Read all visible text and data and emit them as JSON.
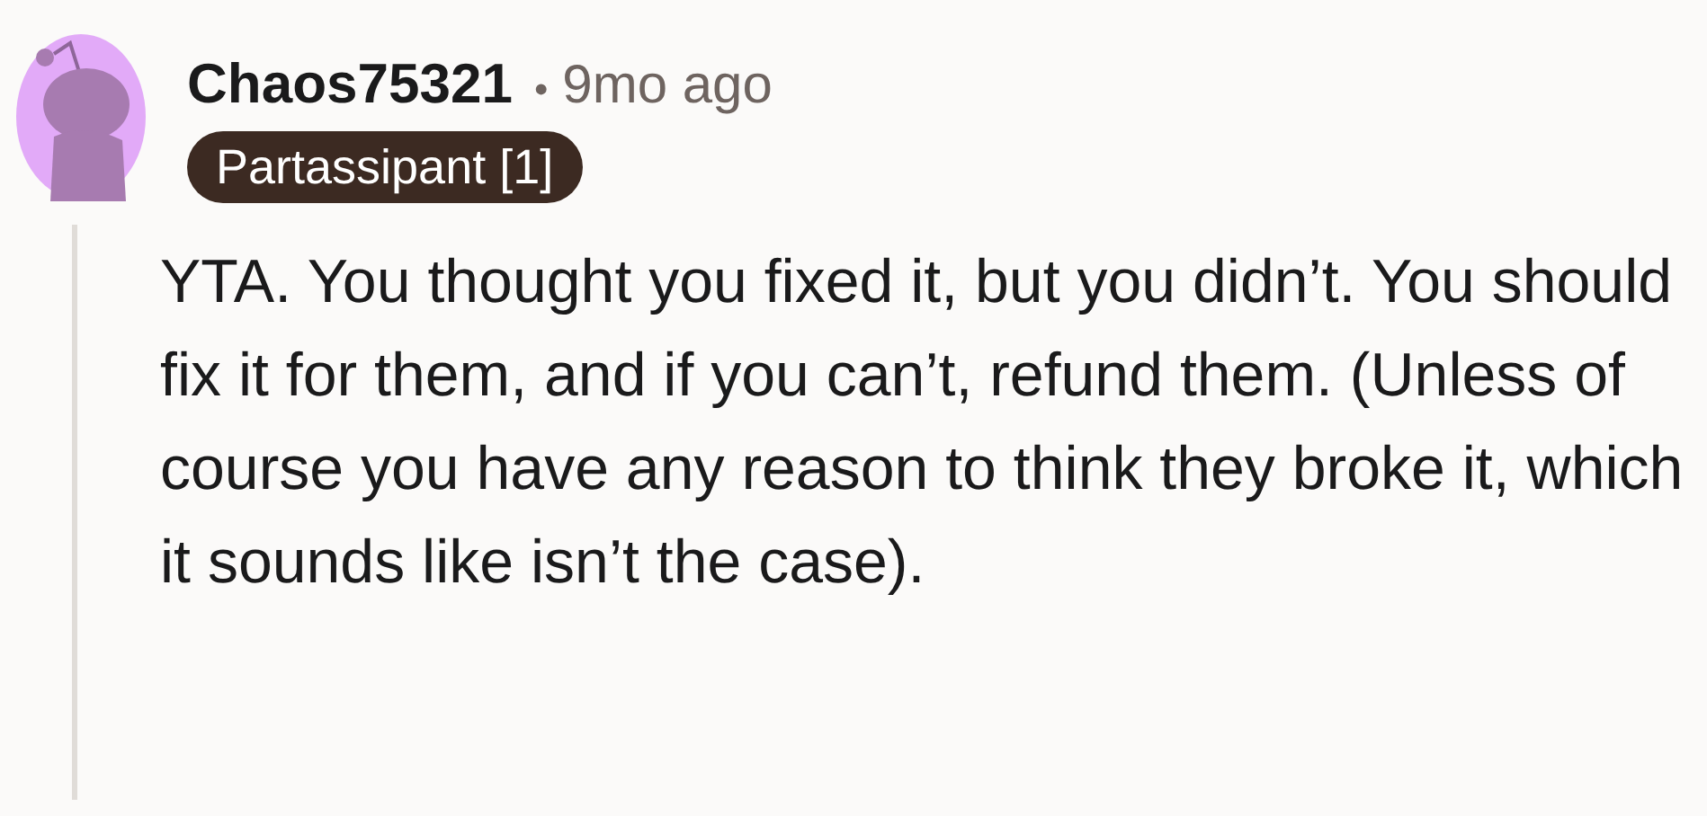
{
  "comment": {
    "author": "Chaos75321",
    "separator": "•",
    "time": "9mo ago",
    "flair": "Partassipant [1]",
    "body": "YTA. You thought you fixed it, but you didn’t. You should fix it for them, and if you can’t, refund them. (Unless of course you have any reason to think they broke it, which it sounds like isn’t the case)."
  }
}
